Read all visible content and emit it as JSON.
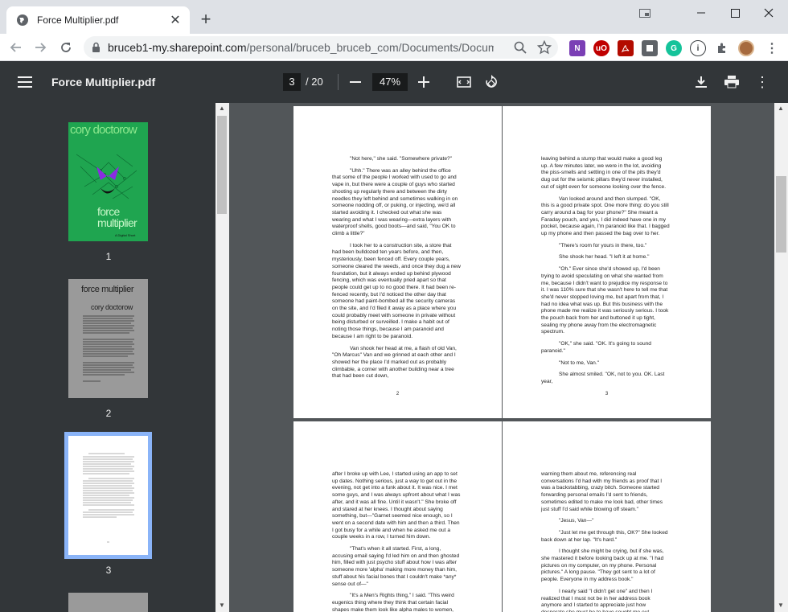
{
  "browser": {
    "tab_title": "Force Multiplier.pdf",
    "tab_close": "✕",
    "new_tab": "+",
    "url_host": "bruceb1-my.sharepoint.com",
    "url_path": "/personal/bruceb_bruceb_com/Documents/Documen...",
    "extensions": [
      "N",
      "uO",
      "",
      "",
      "G",
      "i"
    ]
  },
  "pdf": {
    "title": "Force Multiplier.pdf",
    "current_page": "3",
    "total_pages": "/ 20",
    "zoom": "47%"
  },
  "thumbnails": [
    {
      "label": "1",
      "title_top": "cory doctorow",
      "title_bottom": "force multiplier",
      "subtitle": "A Digital Short"
    },
    {
      "label": "2",
      "title_top": "force multiplier",
      "author": "cory doctorow"
    },
    {
      "label": "3"
    }
  ],
  "pages": {
    "p2": {
      "number": "2",
      "paragraphs": [
        "\"Not here,\" she said. \"Somewhere private?\"",
        "\"Uhh.\" There was an alley behind the office that some of the people I worked with used to go and vape in, but there were a couple of guys who started shooting up regularly there and between the dirty needles they left behind and sometimes walking in on someone nodding off, or puking, or injecting, we'd all started avoiding it. I checked out what she was wearing and what I was wearing—extra layers with waterproof shells, good boots—and said, \"You OK to climb a little?\"",
        "I took her to a construction site, a store that had been bulldozed ten years before, and then, mysteriously, been fenced off. Every couple years, someone cleared the weeds, and once they dug a new foundation, but it always ended up behind plywood fencing, which was eventually pried apart so that people could get up to no good there. It had been re-fenced recently, but I'd noticed the other day that someone had paint-bombed all the security cameras on the site, and I'd filed it away as a place where you could probably meet with someone in private without being disturbed or surveilled. I make a habit out of noting those things, because I am paranoid and because I am right to be paranoid.",
        "Van shook her head at me, a flash of old Van, \"Oh Marcus\" Van and we grinned at each other and I showed her the place I'd marked out as probably climbable, a corner with another building near a tree that had been cut down,"
      ]
    },
    "p3": {
      "number": "3",
      "paragraphs": [
        "leaving behind a stump that would make a good leg up. A few minutes later, we were in the lot, avoiding the piss-smells and settling in one of the pits they'd dug out for the seismic pillars they'd never installed, out of sight even for someone looking over the fence.",
        "Van looked around and then slumped. \"OK, this is a good private spot. One more thing: do you still carry around a bag for your phone?\" She meant a Faraday pouch, and yes, I did indeed have one in my pocket, because again, I'm paranoid like that. I bagged up my phone and then passed the bag over to her.",
        "\"There's room for yours in there, too.\"",
        "She shook her head. \"I left it at home.\"",
        "\"Oh.\" Ever since she'd showed up, I'd been trying to avoid speculating on what she wanted from me, because I didn't want to prejudice my response to it. I was 110% sure that she wasn't here to tell me that she'd never stopped loving me, but apart from that, I had no idea what was up. But this business with the phone made me realize it was seriously serious. I took the pouch back from her and buttoned it up tight, sealing my phone away from the electromagnetic spectrum.",
        "\"OK,\" she said. \"OK. It's going to sound paranoid.\"",
        "\"Not to me, Van.\"",
        "She almost smiled. \"OK, not to you. OK. Last year,"
      ]
    },
    "p4": {
      "paragraphs": [
        "after I broke up with Lee, I started using an app to set up dates. Nothing serious, just a way to get out in the evening, not get into a funk about it. It was nice. I met some guys, and I was always upfront about what I was after, and it was all fine. Until it wasn't.\" She broke off and stared at her knees. I thought about saying something, but—\"Garnet seemed nice enough, so I went on a second date with him and then a third. Then I got busy for a while and when he asked me out a couple weeks in a row, I turned him down.",
        "\"That's when it all started. First, a long, accusing email saying I'd led him on and then ghosted him, filled with just psycho stuff about how I was after someone more 'alpha' making more money than him, stuff about his facial bones that I couldn't make *any* sense out of—\"",
        "\"It's a Men's Rights thing,\" I said. \"This weird eugenics thing where they think that certain facial shapes make them look like alpha males to women, and they're obsessed with it.\""
      ]
    },
    "p5": {
      "paragraphs": [
        "warning them about me, referencing real conversations I'd had with my friends as proof that I was a backstabbing, crazy bitch. Someone started forwarding personal emails I'd sent to friends, sometimes edited to make me look bad, other times just stuff I'd said while blowing off steam.\"",
        "\"Jesus, Van—\"",
        "\"Just let me get through this, OK?\" She looked back down at her lap. \"It's hard.\"",
        "I thought she might be crying, but if she was, she mastered it before looking back up at me. \"I had pictures on my computer, on my phone. Personal pictures.\" A long pause. \"They got sent to a lot of people. Everyone in my address book.\"",
        "I nearly said \"I didn't get one\" and then I realized that I must not be in her address book anymore and I started to appreciate just how desperate she must be to have sought me out."
      ]
    }
  },
  "colors": {
    "pdf_toolbar": "#323639",
    "viewer_bg": "#525659",
    "thumb_selected": "#8ab4f8",
    "cover_green": "#1fa550"
  }
}
